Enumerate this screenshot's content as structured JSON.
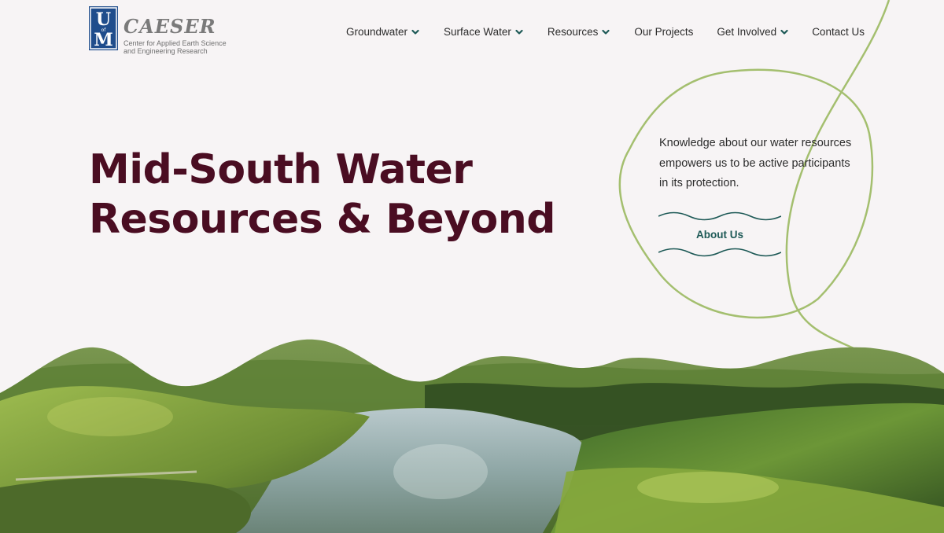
{
  "header": {
    "logo": {
      "mark_letters": "U M",
      "mark_small": "of",
      "title": "CAESER",
      "subtitle": "Center for Applied Earth Science and Engineering Research",
      "mark_color": "#1f4d8c"
    },
    "nav": [
      {
        "label": "Groundwater",
        "has_dropdown": true
      },
      {
        "label": "Surface Water",
        "has_dropdown": true
      },
      {
        "label": "Resources",
        "has_dropdown": true
      },
      {
        "label": "Our Projects",
        "has_dropdown": false
      },
      {
        "label": "Get Involved",
        "has_dropdown": true
      },
      {
        "label": "Contact Us",
        "has_dropdown": false
      }
    ]
  },
  "hero": {
    "title_line1": "Mid-South Water",
    "title_line2": "Resources & Beyond",
    "tagline": "Knowledge about our water resources empowers us to be active participants in its protection.",
    "cta_label": "About Us"
  },
  "icons": {
    "dropdown": "chevron-down-icon",
    "wave": "wave-line-icon"
  },
  "colors": {
    "background": "#f7f4f5",
    "title": "#4a0d22",
    "accent_teal": "#1d5956",
    "deco_green": "#a4bf6f",
    "chevron": "#1d5956"
  }
}
